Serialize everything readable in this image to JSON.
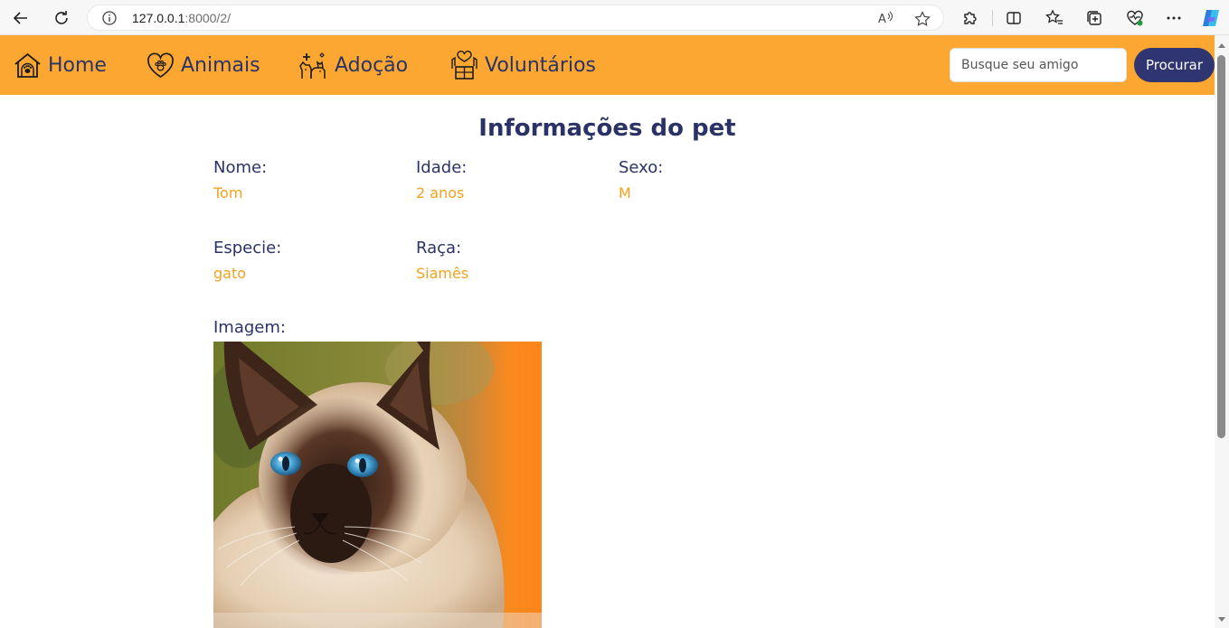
{
  "browser": {
    "url_host": "127.0.0.1",
    "url_rest": ":8000/2/"
  },
  "nav": {
    "items": [
      {
        "label": "Home",
        "icon": "house-paw-icon"
      },
      {
        "label": "Animais",
        "icon": "heart-paw-icon"
      },
      {
        "label": "Adoção",
        "icon": "pets-icon"
      },
      {
        "label": "Voluntários",
        "icon": "hands-box-icon"
      }
    ],
    "search_placeholder": "Busque seu amigo",
    "search_button": "Procurar"
  },
  "pet": {
    "title": "Informações do pet",
    "fields": [
      {
        "label": "Nome:",
        "value": "Tom"
      },
      {
        "label": "Idade:",
        "value": "2 anos"
      },
      {
        "label": "Sexo:",
        "value": "M"
      },
      {
        "label": "Especie:",
        "value": "gato"
      },
      {
        "label": "Raça:",
        "value": "Siamês"
      }
    ],
    "image_label": "Imagem:"
  },
  "colors": {
    "navbar": "#fba732",
    "primary_text": "#2b3366",
    "value_text": "#f4a21e",
    "button": "#2e3570"
  }
}
